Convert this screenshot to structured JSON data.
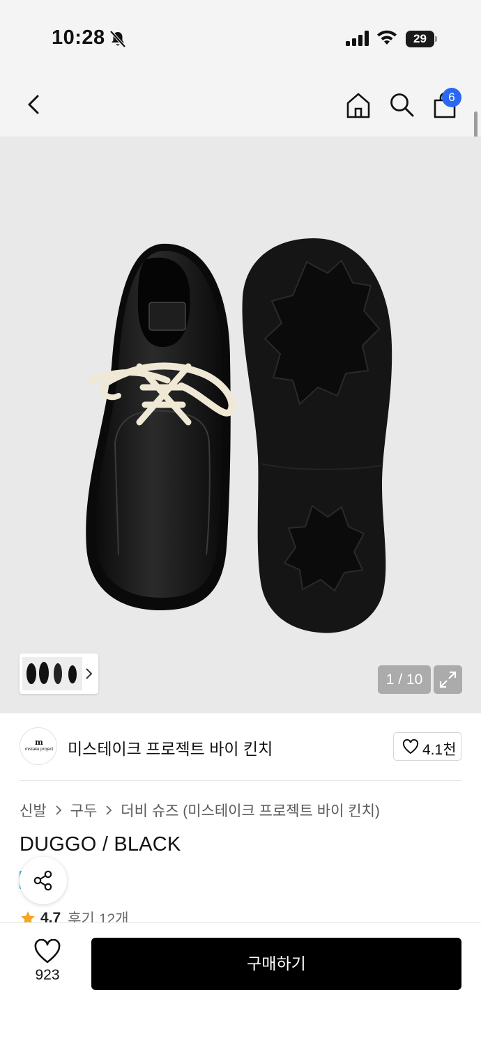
{
  "status_bar": {
    "time": "10:28",
    "battery": "29",
    "icons": [
      "bell-off-icon",
      "signal-icon",
      "wifi-icon",
      "battery-icon"
    ]
  },
  "nav": {
    "icons": [
      "back-icon",
      "home-icon",
      "search-icon",
      "cart-icon"
    ],
    "cart_badge": "6"
  },
  "gallery": {
    "page_counter": "1 / 10",
    "icons": [
      "chevron-right-icon",
      "expand-icon"
    ]
  },
  "brand": {
    "name": "미스테이크 프로젝트 바이 킨치",
    "like_count": "4.1천",
    "logo_text": "mistake project"
  },
  "breadcrumb": [
    "신발",
    "구두",
    "더비 슈즈 (미스테이크 프로젝트 바이 킨치)"
  ],
  "product": {
    "title": "DUGGO / BLACK",
    "rating": "4.7",
    "review_label": "후기",
    "review_count": "12개"
  },
  "bottom_bar": {
    "wish_count": "923",
    "buy_label": "구매하기"
  },
  "colors": {
    "accent_badge": "#2a68f4",
    "star": "#f5a623",
    "buy_button": "#000000"
  }
}
